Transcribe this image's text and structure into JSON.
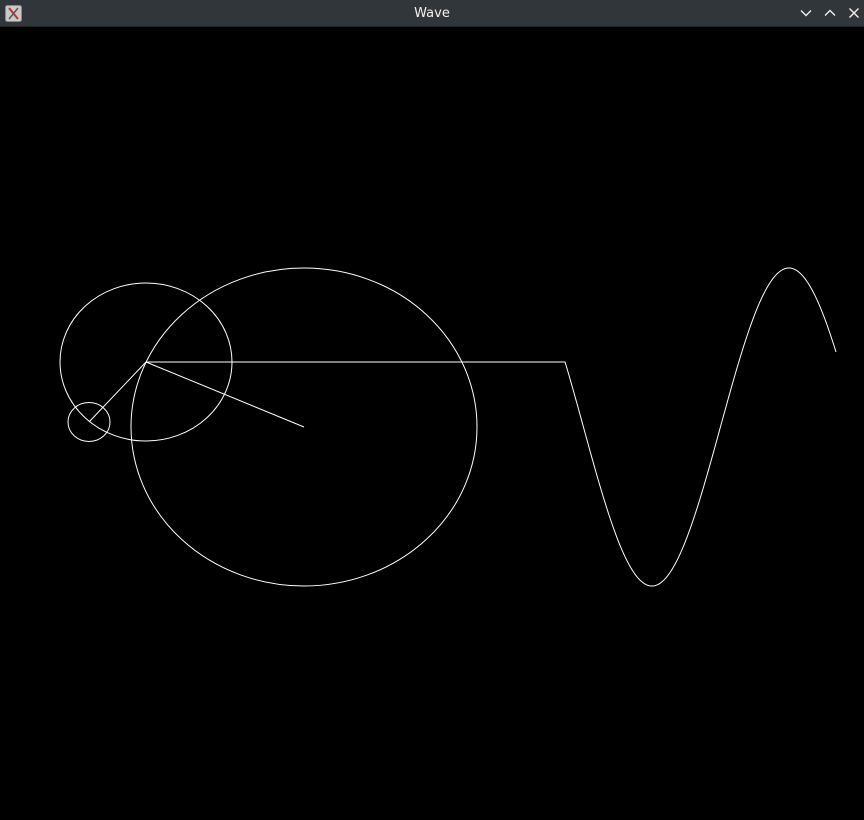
{
  "window": {
    "title": "Wave",
    "buttons": {
      "minimize": "chevron-down-icon",
      "maximize": "chevron-up-icon",
      "close": "close-icon"
    },
    "titlebar_color": "#31363b",
    "title_color": "#eff0f1"
  },
  "canvas": {
    "background": "#000000",
    "stroke": "#ffffff"
  }
}
